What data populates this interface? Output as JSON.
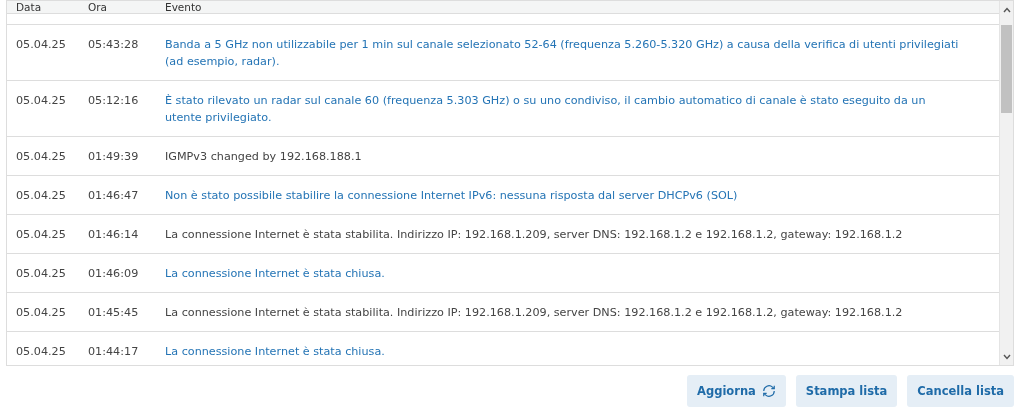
{
  "table": {
    "columns": [
      "Data",
      "Ora",
      "Evento"
    ],
    "rows": [
      {
        "date": "05.04.25",
        "time": "05:43:28",
        "event": "Banda a 5 GHz non utilizzabile per 1 min sul canale selezionato 52-64 (frequenza 5.260-5.320 GHz) a causa della verifica di utenti privilegiati (ad esempio, radar).",
        "kind": "link"
      },
      {
        "date": "05.04.25",
        "time": "05:12:16",
        "event": "È stato rilevato un radar sul canale 60 (frequenza 5.303 GHz) o su uno condiviso, il cambio automatico di canale è stato eseguito da un utente privilegiato.",
        "kind": "link"
      },
      {
        "date": "05.04.25",
        "time": "01:49:39",
        "event": "IGMPv3 changed by 192.168.188.1",
        "kind": "text"
      },
      {
        "date": "05.04.25",
        "time": "01:46:47",
        "event": "Non è stato possibile stabilire la connessione Internet IPv6: nessuna risposta dal server DHCPv6 (SOL)",
        "kind": "link"
      },
      {
        "date": "05.04.25",
        "time": "01:46:14",
        "event": "La connessione Internet è stata stabilita. Indirizzo IP: 192.168.1.209, server DNS: 192.168.1.2 e 192.168.1.2, gateway: 192.168.1.2",
        "kind": "text"
      },
      {
        "date": "05.04.25",
        "time": "01:46:09",
        "event": "La connessione Internet è stata chiusa.",
        "kind": "link"
      },
      {
        "date": "05.04.25",
        "time": "01:45:45",
        "event": "La connessione Internet è stata stabilita. Indirizzo IP: 192.168.1.209, server DNS: 192.168.1.2 e 192.168.1.2, gateway: 192.168.1.2",
        "kind": "text"
      },
      {
        "date": "05.04.25",
        "time": "01:44:17",
        "event": "La connessione Internet è stata chiusa.",
        "kind": "link"
      }
    ]
  },
  "buttons": [
    {
      "label": "Aggiorna",
      "kind": "refresh"
    },
    {
      "label": "Stampa lista",
      "kind": "plain"
    },
    {
      "label": "Cancella lista",
      "kind": "plain"
    }
  ]
}
